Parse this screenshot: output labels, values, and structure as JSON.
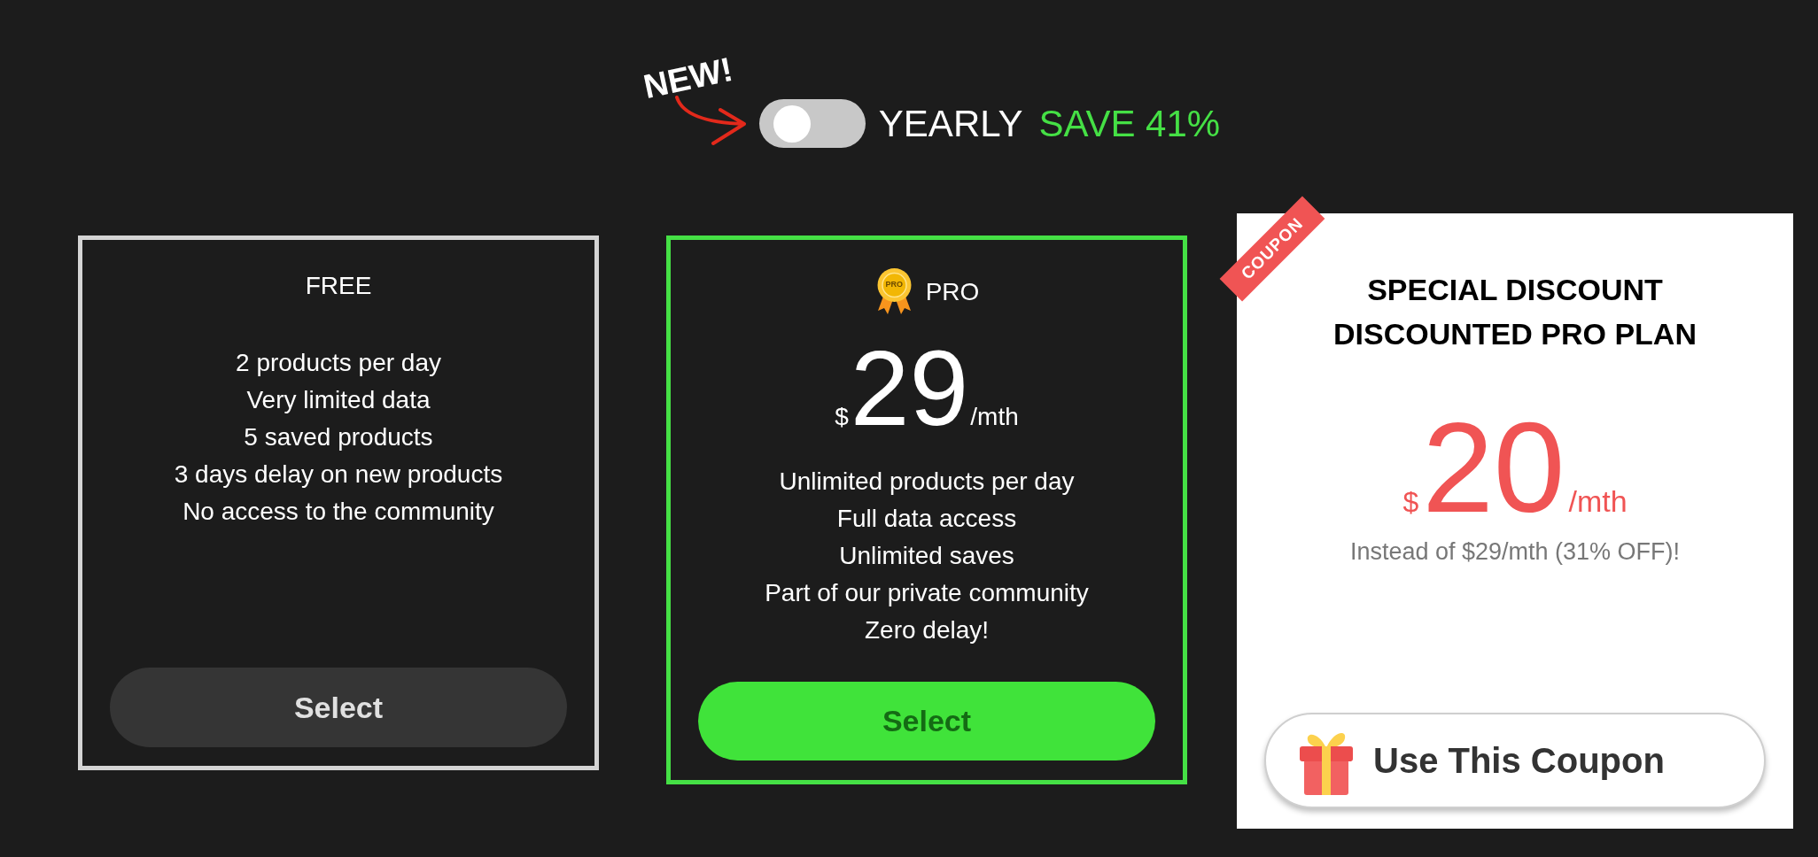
{
  "header": {
    "badge": "NEW!",
    "toggle": {
      "on": false
    },
    "label": "YEARLY",
    "savings": "SAVE 41%"
  },
  "plans": [
    {
      "kind": "basic",
      "name": "FREE",
      "features": [
        "2 products per day",
        "Very limited data",
        "5 saved products",
        "3 days delay on new products",
        "No access to the community"
      ],
      "button": "Select"
    },
    {
      "kind": "featured",
      "medal_label": "PRO",
      "name": "PRO",
      "price": {
        "currency": "$",
        "amount": "29",
        "period": "/mth"
      },
      "features": [
        "Unlimited products per day",
        "Full data access",
        "Unlimited saves",
        "Part of our private community",
        "Zero delay!"
      ],
      "button": "Select"
    },
    {
      "kind": "coupon",
      "ribbon": "COUPON",
      "heading": "SPECIAL DISCOUNT",
      "name": "DISCOUNTED PRO PLAN",
      "price": {
        "currency": "$",
        "amount": "20",
        "period": "/mth"
      },
      "note": "Instead of $29/mth (31% OFF)!",
      "button": "Use This Coupon"
    }
  ]
}
